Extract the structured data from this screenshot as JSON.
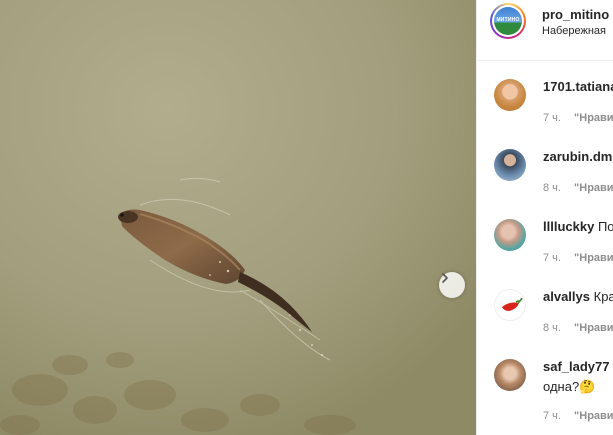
{
  "post": {
    "author": "pro_mitino",
    "location": "Набережная",
    "avatar_logo_text": "МИТИНО"
  },
  "media": {
    "description": "Muskrat swimming in murky water",
    "next_icon": "chevron-right-icon"
  },
  "comments": [
    {
      "username": "1701.tatiana",
      "text": "",
      "line2": "",
      "time": "7 ч.",
      "like": "\"Нрави"
    },
    {
      "username": "zarubin.dm",
      "text": "",
      "line2": "",
      "time": "8 ч.",
      "like": "\"Нрави"
    },
    {
      "username": "lllluckky",
      "text": "По",
      "line2": "",
      "time": "7 ч.",
      "like": "\"Нрави"
    },
    {
      "username": "alvallys",
      "text": "Кра",
      "line2": "",
      "time": "8 ч.",
      "like": "\"Нрави"
    },
    {
      "username": "saf_lady77",
      "text": "",
      "line2": "одна?🤔",
      "time": "7 ч.",
      "like": "\"Нрави"
    }
  ],
  "colors": {
    "water": "#a49f7c",
    "text": "#262626",
    "meta": "#8e8e8e",
    "divider": "#efefef"
  }
}
